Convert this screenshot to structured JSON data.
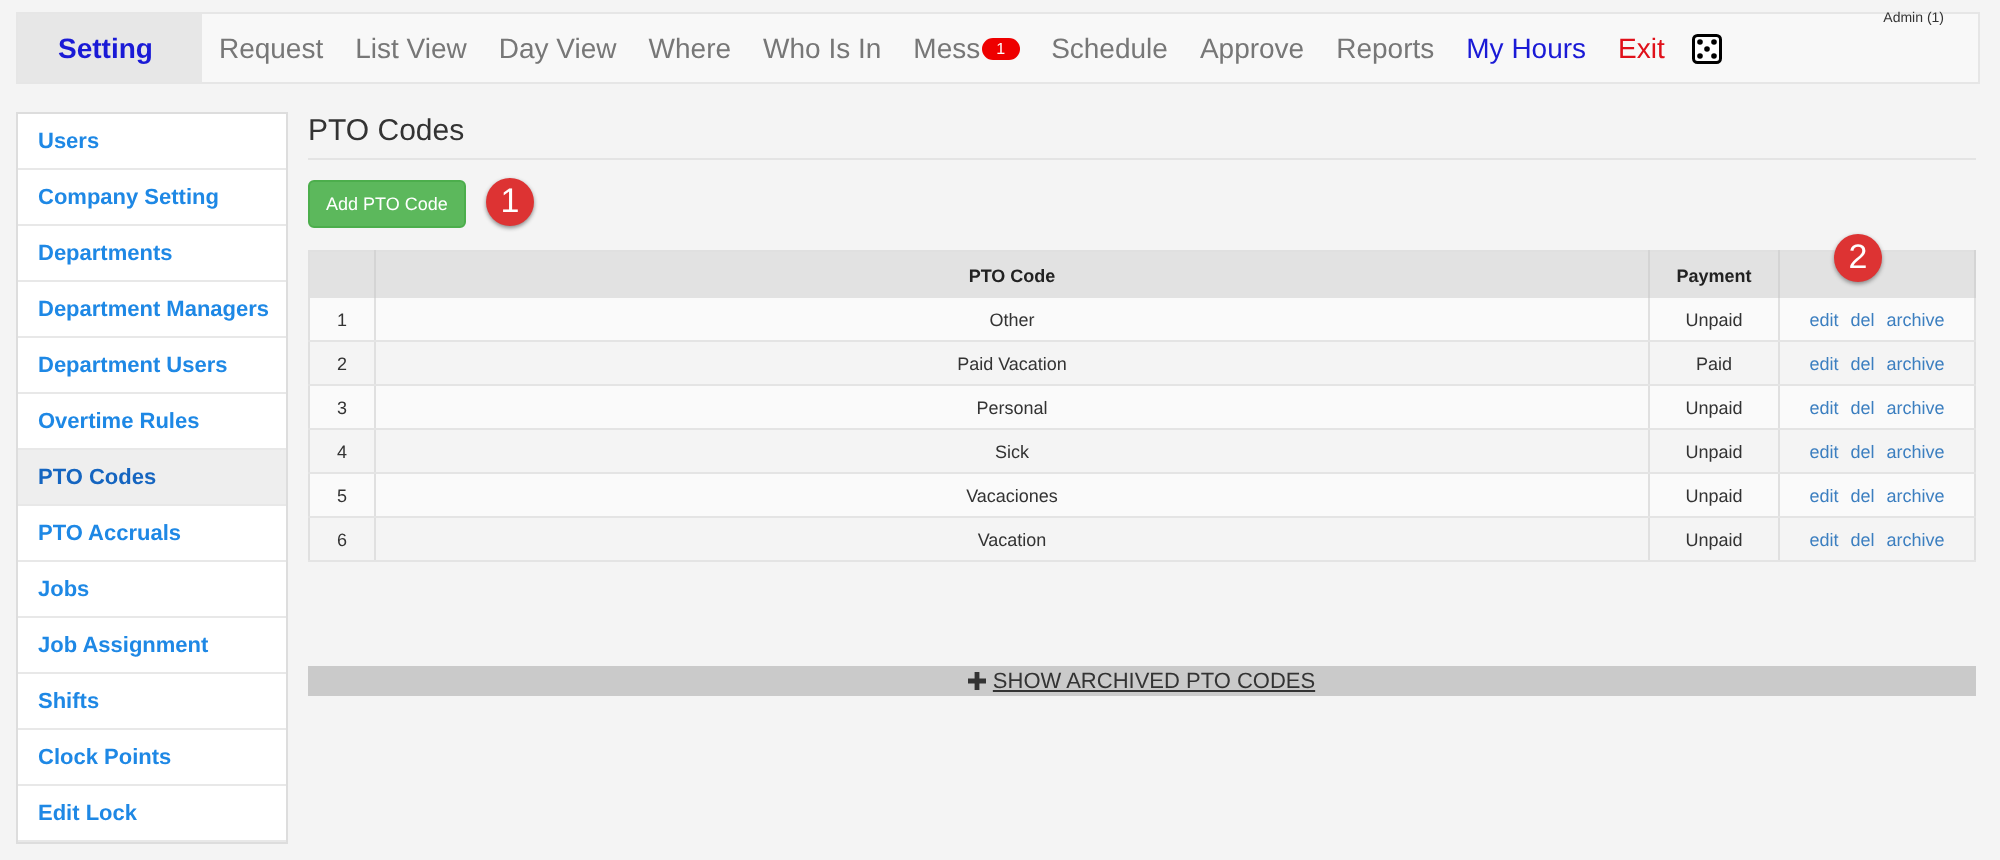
{
  "user_label": "Admin (1)",
  "nav": [
    {
      "label": "Setting",
      "kind": "tab",
      "selected": true
    },
    {
      "label": "Request",
      "kind": "tab",
      "selected": false
    },
    {
      "label": "List View",
      "kind": "tab",
      "selected": false
    },
    {
      "label": "Day View",
      "kind": "tab",
      "selected": false
    },
    {
      "label": "Where",
      "kind": "tab",
      "selected": false
    },
    {
      "label": "Who Is In",
      "kind": "tab",
      "selected": false
    },
    {
      "label": "Mess",
      "kind": "tab",
      "selected": false,
      "badge": "1"
    },
    {
      "label": "Schedule",
      "kind": "tab",
      "selected": false
    },
    {
      "label": "Approve",
      "kind": "tab",
      "selected": false
    },
    {
      "label": "Reports",
      "kind": "tab",
      "selected": false
    },
    {
      "label": "My Hours",
      "kind": "link",
      "selected": false
    },
    {
      "label": "Exit",
      "kind": "danger",
      "selected": false
    },
    {
      "kind": "icon"
    }
  ],
  "sidebar": {
    "items": [
      {
        "label": "Users",
        "selected": false
      },
      {
        "label": "Company Setting",
        "selected": false
      },
      {
        "label": "Departments",
        "selected": false
      },
      {
        "label": "Department Managers",
        "selected": false
      },
      {
        "label": "Department Users",
        "selected": false
      },
      {
        "label": "Overtime Rules",
        "selected": false
      },
      {
        "label": "PTO Codes",
        "selected": true
      },
      {
        "label": "PTO Accruals",
        "selected": false
      },
      {
        "label": "Jobs",
        "selected": false
      },
      {
        "label": "Job Assignment",
        "selected": false
      },
      {
        "label": "Shifts",
        "selected": false
      },
      {
        "label": "Clock Points",
        "selected": false
      },
      {
        "label": "Edit Lock",
        "selected": false
      }
    ]
  },
  "title": "PTO Codes",
  "add_button": "Add PTO Code",
  "callouts": [
    "1",
    "2"
  ],
  "table": {
    "columns": [
      "PTO Code",
      "Payment"
    ],
    "rows": [
      {
        "index": "1",
        "code": "Other",
        "payment": "Unpaid",
        "actions": [
          "edit",
          "del",
          "archive"
        ]
      },
      {
        "index": "2",
        "code": "Paid Vacation",
        "payment": "Paid",
        "actions": [
          "edit",
          "del",
          "archive"
        ]
      },
      {
        "index": "3",
        "code": "Personal",
        "payment": "Unpaid",
        "actions": [
          "edit",
          "del",
          "archive"
        ]
      },
      {
        "index": "4",
        "code": "Sick",
        "payment": "Unpaid",
        "actions": [
          "edit",
          "del",
          "archive"
        ]
      },
      {
        "index": "5",
        "code": "Vacaciones",
        "payment": "Unpaid",
        "actions": [
          "edit",
          "del",
          "archive"
        ]
      },
      {
        "index": "6",
        "code": "Vacation",
        "payment": "Unpaid",
        "actions": [
          "edit",
          "del",
          "archive"
        ]
      }
    ]
  },
  "show_archived": "SHOW ARCHIVED PTO CODES"
}
